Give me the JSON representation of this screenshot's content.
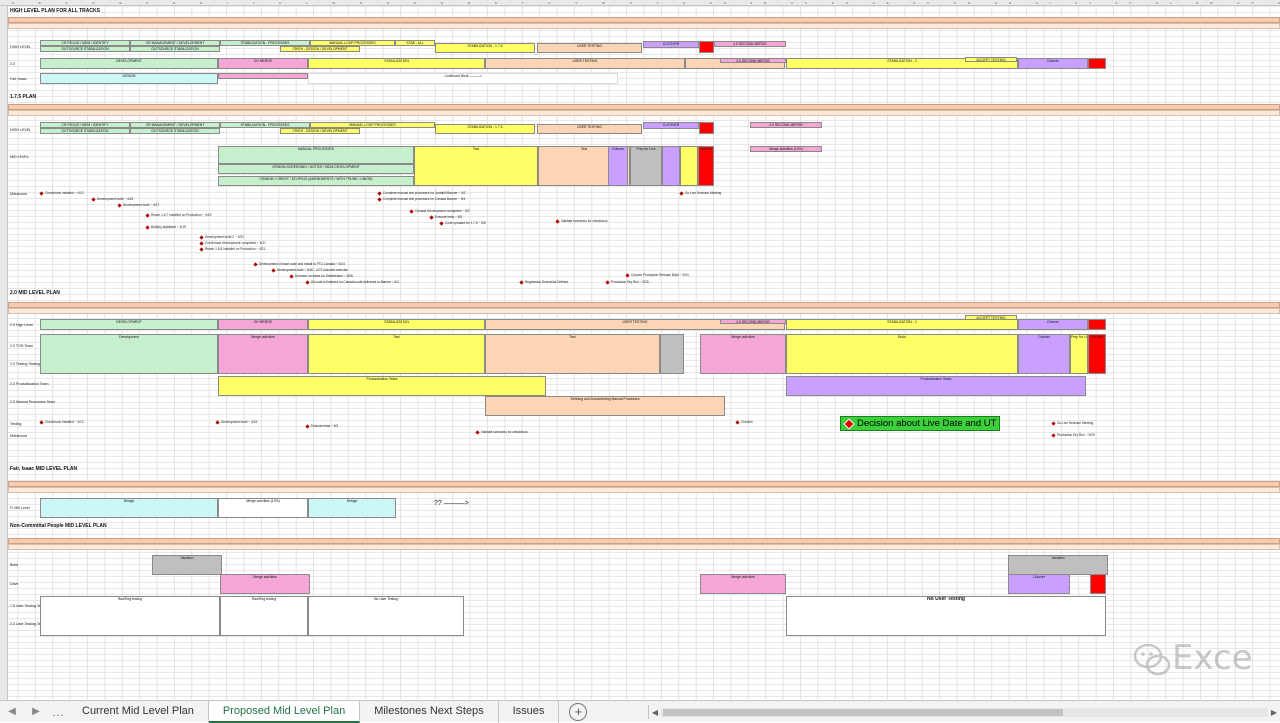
{
  "sheet": {
    "sections": [
      {
        "id": "s1",
        "title": "HIGH LEVEL PLAN FOR ALL TRACKS"
      },
      {
        "id": "s2",
        "title": "1.7.5 PLAN"
      },
      {
        "id": "s3",
        "title": "2.0 MID LEVEL PLAN"
      },
      {
        "id": "s4",
        "title": "Fair, Isaac MID LEVEL PLAN"
      },
      {
        "id": "s5",
        "title": "Non-Committal People MID LEVEL PLAN"
      }
    ],
    "row_labels": {
      "high_level": "HIGH LEVEL",
      "v20": "2.0",
      "fair_isaac": "Fair, Isaac",
      "mid_level": "MID LEVEL",
      "milestones": "Milestones",
      "v20_high": "2.0 High Level",
      "tester_team": "2.0 TOR Team",
      "testing_strategy": "2.0 Testing Strategy Team",
      "productization": "2.0 Productization Team",
      "manual_processes": "2.0 Manual Processes Team",
      "testing": "Testing",
      "milestones2": "Milestones",
      "fi_mid": "FI Mid Level",
      "build": "Build",
      "dave": "Dave",
      "user_testing": "7.5 User Testing Team",
      "user_testing2": "2.0 User Testing Team"
    },
    "bars": {
      "dev": "DEVELOPMENT",
      "dev_b": "Development",
      "cr_fields": "CR FIELDS / MDM / IDENTIFY",
      "outsource_stab": "OUTSOURCE STABILIZATION",
      "cr_mgmt": "CR MANAGEMENT / DEVELOPMENT",
      "stab_processes": "STABILIZATION - PROCESSES",
      "manual_processes": "MANUAL LOOP PROCESSES",
      "cr_design": "CR/EH - DESIGN / DEVELOPMENT",
      "stab_all": "STAB - ALL",
      "stab_175": "STABILIZATION - 1.7.5",
      "user_testing": "USER TESTING",
      "cutover": "CUTOVER",
      "second_merge": "2.0 SECOND MERGE",
      "dv_merge": "DV MERGE",
      "stabilization": "STABILIZATION",
      "stab_2": "STABILIZATION - 2",
      "accept_testing": "ACCEPT TESTING",
      "cutover_b": "Cutover",
      "design": "DESIGN",
      "continued": "Continued Work ———>",
      "merge_activities": "Merge activities (10%)",
      "manual_proc_b": "MANUAL PROCESSES",
      "cr_screening": "CR/NON-SCREENING / NOTICE / MDM DEVELOPMENT",
      "cr_mdm": "CR/MDM / CREDIT / SCOPING (AMENDMENTS / WITH TRUNK / UNION)",
      "merge_act": "Merge activities",
      "productization_tasks": "Productization Tasks",
      "defining_docs": "Defining and Documenting Manual Processes",
      "design_b": "Design",
      "merge_10": "Merge activities (10%)",
      "qq": "?? ———>",
      "vacation": "Vacation",
      "no_user_testing": "No User Testing",
      "rad_reg": "Rad/Reg testing",
      "no_user": "No User Testing",
      "regression": "Regression Testing",
      "acceptance": "Acceptance Testing",
      "prep_live": "Prep for Live",
      "go_live": "Go Live",
      "test": "Test",
      "build_bar": "Build",
      "stab_maint": "Stabilize / Maintenance"
    },
    "milestones": [
      "Checkbook Installed ~ 4/13",
      "Development build ~ 4/15",
      "Development build ~ 4/17",
      "Reach 1.6.7 Installed on Production ~ 4/19",
      "Build(s) stabilized ~ 4/19",
      "Development build 2 ~ 4/21",
      "Credit base development completed ~ 4/21",
      "Reach 1.6.8 Installed on Production ~ 4/21",
      "Development of base code and install to PTU Canada ~ 5/24",
      "Development build ~ 6/20 - UCT includes exercise",
      "Decision on dates for Stabilization ~ 5/26",
      "All code is finalized on Canada code delivered to Banner ~ 6/1",
      "Complete manual test processes for Justabill Banner ~ 5/2",
      "Complete manual test processes for Canada Banner ~ 5/4",
      "Canada Development completed ~ 5/2",
      "Execute tests ~ 5/3",
      "Code updated for 1.7.5 ~ 5/5",
      "Validate scenarios for checkbook",
      "Go Live Decision Meeting",
      "Prep for Live",
      "Go Live",
      "Regression Scenarios Defined",
      "Production Dry Run ~ 9/20",
      "Cutover Production Release Build ~ 9/24",
      "Checkin"
    ],
    "decision": "Decision about Live Date and UT",
    "watermark": "Exce"
  },
  "tabs": [
    {
      "label": "Current Mid Level Plan"
    },
    {
      "label": "Proposed Mid Level Plan"
    },
    {
      "label": "Milestones Next Steps"
    },
    {
      "label": "Issues"
    }
  ],
  "tab_nav": {
    "prev": "◀",
    "next": "▶",
    "more": "…",
    "add": "+"
  },
  "scroll": {
    "left": "◀",
    "right": "▶"
  }
}
